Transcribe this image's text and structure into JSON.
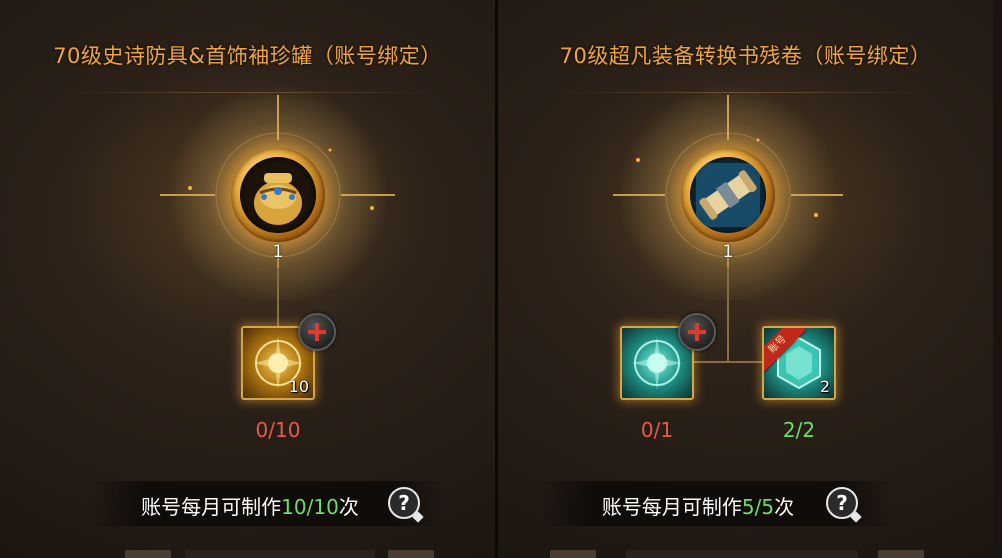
{
  "panels": [
    {
      "title": "70级史诗防具&首饰袖珍罐（账号绑定）",
      "main_item": {
        "icon": "treasure-jar-icon",
        "count": "1"
      },
      "materials": [
        {
          "icon": "golden-orb-material-icon",
          "qty": "10",
          "ratio": "0/10",
          "ratio_status": "insufficient"
        }
      ],
      "monthly_limit": {
        "prefix": "账号每月可制作",
        "value": "10/10",
        "suffix": "次"
      }
    },
    {
      "title": "70级超凡装备转换书残卷（账号绑定）",
      "main_item": {
        "icon": "scroll-icon",
        "count": "1"
      },
      "materials": [
        {
          "icon": "teal-orb-material-icon",
          "qty": "",
          "ratio": "0/1",
          "ratio_status": "insufficient"
        },
        {
          "icon": "teal-crystal-material-icon",
          "qty": "2",
          "badge": "账号",
          "ratio": "2/2",
          "ratio_status": "sufficient"
        }
      ],
      "monthly_limit": {
        "prefix": "账号每月可制作",
        "value": "5/5",
        "suffix": "次"
      }
    }
  ],
  "colors": {
    "title": "#f0a43c",
    "insufficient": "#e55a4e",
    "sufficient": "#6fdc62",
    "limit_value": "#6fdc62"
  }
}
